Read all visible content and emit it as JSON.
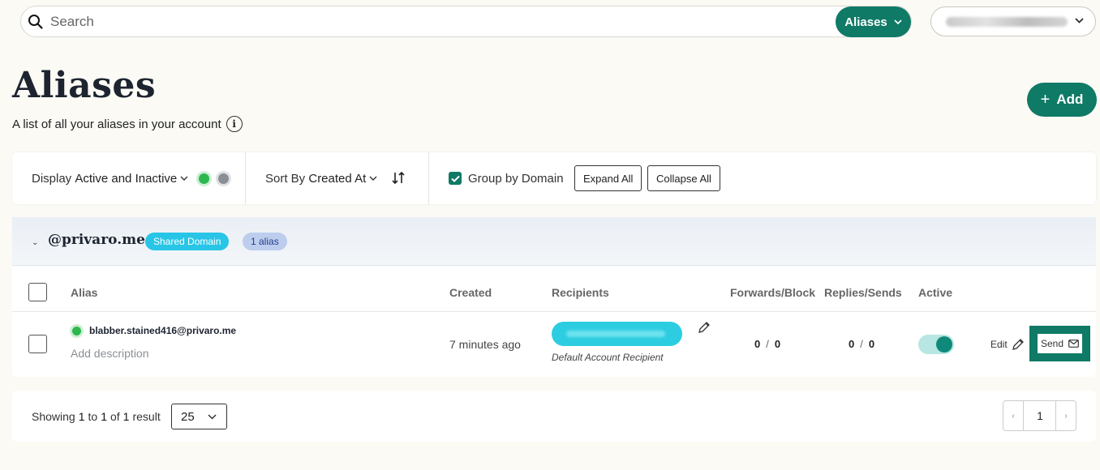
{
  "header": {
    "search_placeholder": "Search",
    "scope_label": "Aliases"
  },
  "page": {
    "title": "Aliases",
    "subtitle": "A list of all your aliases in your account",
    "add_label": "Add"
  },
  "filters": {
    "display_prefix": "Display",
    "display_value": "Active and Inactive",
    "sort_prefix": "Sort By",
    "sort_value": "Created At",
    "group_label": "Group by Domain",
    "group_checked": true,
    "expand_label": "Expand All",
    "collapse_label": "Collapse All"
  },
  "domain_group": {
    "name": "@privaro.me",
    "type_badge": "Shared Domain",
    "count_badge": "1 alias"
  },
  "table": {
    "columns": [
      "Alias",
      "Created",
      "Recipients",
      "Forwards/Blocks",
      "Replies/Sends",
      "Active"
    ],
    "rows": [
      {
        "alias": "blabber.stained416@privaro.me",
        "description_placeholder": "Add description",
        "created": "7 minutes ago",
        "recipient_note": "Default Account Recipient",
        "forwards": "0",
        "blocks": "0",
        "replies": "0",
        "sends": "0",
        "separator": "/",
        "active": true,
        "edit_label": "Edit",
        "send_label": "Send"
      }
    ]
  },
  "footer": {
    "showing_prefix": "Showing",
    "from": "1",
    "to_word": "to",
    "to": "1",
    "of_word": "of",
    "total": "1",
    "result_word": "result",
    "per_page": "25",
    "current_page": "1",
    "prev_glyph": "‹",
    "next_glyph": "›"
  },
  "colors": {
    "brand": "#0f7a66",
    "active_dot": "#2db84f",
    "inactive_dot": "#8a8f95",
    "shared_badge": "#28c5e6",
    "count_badge": "#bccdee"
  }
}
